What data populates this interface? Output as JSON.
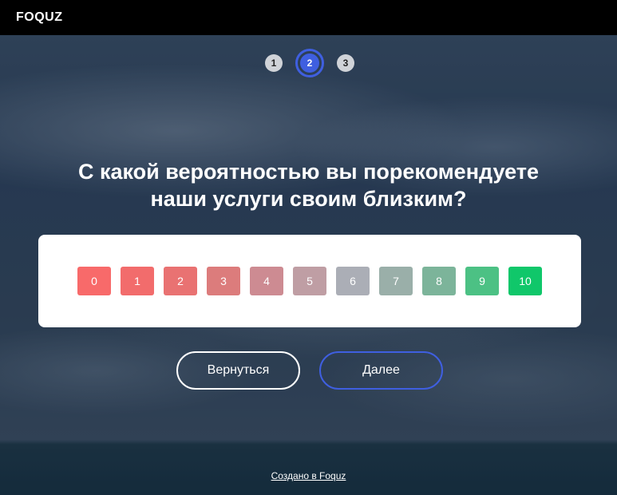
{
  "header": {
    "logo": "FOQUZ"
  },
  "stepper": {
    "steps": [
      {
        "label": "1",
        "state": "default"
      },
      {
        "label": "2",
        "state": "active"
      },
      {
        "label": "3",
        "state": "default"
      }
    ],
    "active_color": "#3f5fe0"
  },
  "question": {
    "line1": "С какой вероятностью вы порекомендуете",
    "line2": "наши услуги своим близким?"
  },
  "scale": {
    "options": [
      {
        "label": "0",
        "color": "#f86a6a"
      },
      {
        "label": "1",
        "color": "#f26c6c"
      },
      {
        "label": "2",
        "color": "#e97272"
      },
      {
        "label": "3",
        "color": "#dc7c7c"
      },
      {
        "label": "4",
        "color": "#cd8b92"
      },
      {
        "label": "5",
        "color": "#bf9ea4"
      },
      {
        "label": "6",
        "color": "#abaeb6"
      },
      {
        "label": "7",
        "color": "#9aafa9"
      },
      {
        "label": "8",
        "color": "#7cb49a"
      },
      {
        "label": "9",
        "color": "#4cc184"
      },
      {
        "label": "10",
        "color": "#10c76a"
      }
    ]
  },
  "buttons": {
    "back_label": "Вернуться",
    "next_label": "Далее"
  },
  "footer": {
    "link_label": "Создано в Foquz"
  }
}
